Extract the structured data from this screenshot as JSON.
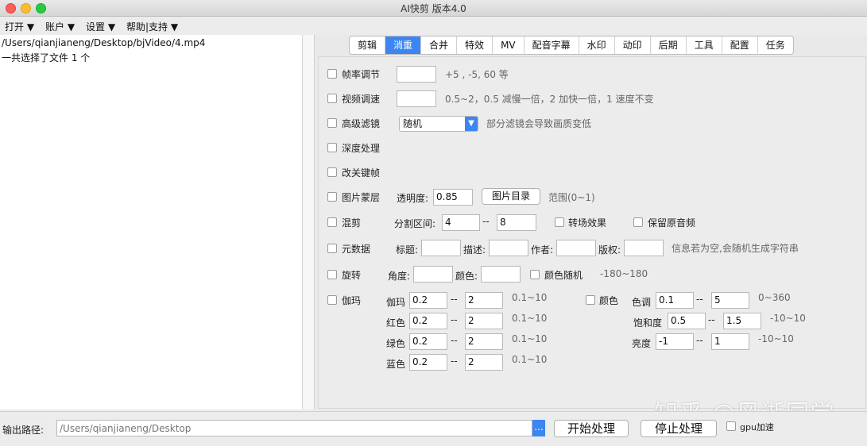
{
  "window": {
    "title": "AI快剪  版本4.0"
  },
  "menubar": [
    "打开 ▼",
    "账户 ▼",
    "设置 ▼",
    "帮助|支持 ▼"
  ],
  "left_pane": {
    "path": "/Users/qianjianeng/Desktop/bjVideo/4.mp4",
    "summary": "一共选择了文件 1 个"
  },
  "tabs": [
    "剪辑",
    "消重",
    "合并",
    "特效",
    "MV",
    "配音字幕",
    "水印",
    "动印",
    "后期",
    "工具",
    "配置",
    "任务"
  ],
  "active_tab": "消重",
  "options": {
    "frame_rate": {
      "label": "帧率调节",
      "value": "",
      "hint": "+5 , -5, 60 等"
    },
    "video_speed": {
      "label": "视频调速",
      "value": "",
      "hint": "0.5~2，0.5 减慢一倍，2 加快一倍，1 速度不变"
    },
    "filter": {
      "label": "高级滤镜",
      "selected": "随机",
      "hint": "部分滤镜会导致画质变低"
    },
    "deep": {
      "label": "深度处理"
    },
    "keyframe": {
      "label": "改关键帧"
    },
    "image_mask": {
      "label": "图片蒙层",
      "opacity_label": "透明度:",
      "opacity_value": "0.85",
      "dir_button": "图片目录",
      "hint": "范围(0~1)"
    },
    "mix": {
      "label": "混剪",
      "range_label": "分割区间:",
      "range_from": "4",
      "range_sep": "--",
      "range_to": "8",
      "transition": "转场效果",
      "keep_audio": "保留原音频"
    },
    "metadata": {
      "label": "元数据",
      "title_label": "标题:",
      "desc_label": "描述:",
      "author_label": "作者:",
      "copyright_label": "版权:",
      "hint": "信息若为空,会随机生成字符串"
    },
    "rotate": {
      "label": "旋转",
      "angle_label": "角度:",
      "color_label": "颜色:",
      "color_random": "颜色随机",
      "hint": "-180~180"
    },
    "gamma": {
      "label": "伽玛",
      "rows": [
        {
          "label": "伽玛",
          "from": "0.2",
          "sep": "--",
          "to": "2",
          "hint": "0.1~10"
        },
        {
          "label": "红色",
          "from": "0.2",
          "sep": "--",
          "to": "2",
          "hint": "0.1~10"
        },
        {
          "label": "绿色",
          "from": "0.2",
          "sep": "--",
          "to": "2",
          "hint": "0.1~10"
        },
        {
          "label": "蓝色",
          "from": "0.2",
          "sep": "--",
          "to": "2",
          "hint": "0.1~10"
        }
      ]
    },
    "color": {
      "label": "颜色",
      "rows": [
        {
          "label": "色调",
          "from": "0.1",
          "sep": "--",
          "to": "5",
          "hint": "0~360"
        },
        {
          "label": "饱和度",
          "from": "0.5",
          "sep": "--",
          "to": "1.5",
          "hint": "-10~10"
        },
        {
          "label": "亮度",
          "from": "-1",
          "sep": "--",
          "to": "1",
          "hint": "-10~10"
        }
      ]
    }
  },
  "bottom": {
    "output_label": "输出路径:",
    "output_placeholder": "/Users/qianjianeng/Desktop",
    "browse": "...",
    "start": "开始处理",
    "stop": "停止处理",
    "gpu": "gpu加速"
  },
  "watermark": "知乎 @风逝同学",
  "colors": {
    "accent": "#3b86f2"
  },
  "icons": {
    "traffic_lights": [
      "close-icon",
      "minimize-icon",
      "zoom-icon"
    ],
    "select_arrow": "chevron-down-icon"
  }
}
